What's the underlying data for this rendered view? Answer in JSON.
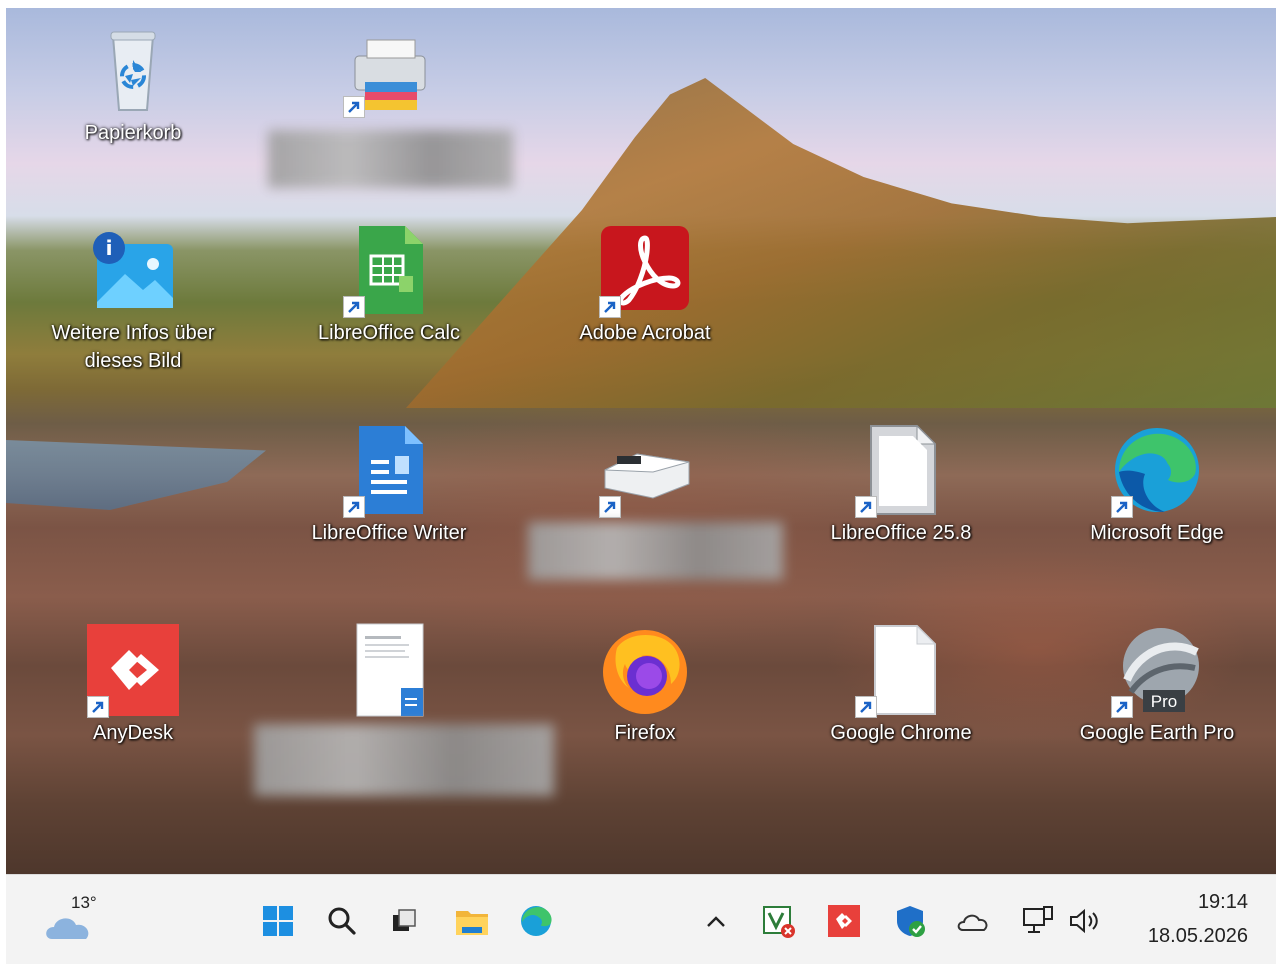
{
  "desktop_icons": [
    {
      "id": "papierkorb",
      "label": "Papierkorb"
    },
    {
      "id": "info",
      "label_line1": "Weitere Infos über",
      "label_line2": "dieses Bild"
    },
    {
      "id": "calc",
      "label": "LibreOffice Calc"
    },
    {
      "id": "acrobat",
      "label": "Adobe Acrobat"
    },
    {
      "id": "writer",
      "label": "LibreOffice Writer"
    },
    {
      "id": "libreoffice",
      "label": "LibreOffice 25.8"
    },
    {
      "id": "edge",
      "label": "Microsoft Edge"
    },
    {
      "id": "anydesk",
      "label": "AnyDesk"
    },
    {
      "id": "firefox",
      "label": "Firefox"
    },
    {
      "id": "chrome",
      "label": "Google Chrome"
    },
    {
      "id": "earth",
      "label": "Google Earth Pro",
      "badge": "Pro"
    }
  ],
  "taskbar": {
    "weather_temp": "13°",
    "clock_time": "19:14",
    "clock_date": "18.05.2026"
  },
  "colors": {
    "taskbar_bg": "#f3f3f3",
    "acrobat_red": "#c8161d",
    "anydesk_red": "#e8403b",
    "calc_green": "#3aa64a",
    "writer_blue": "#2c7ed6"
  }
}
